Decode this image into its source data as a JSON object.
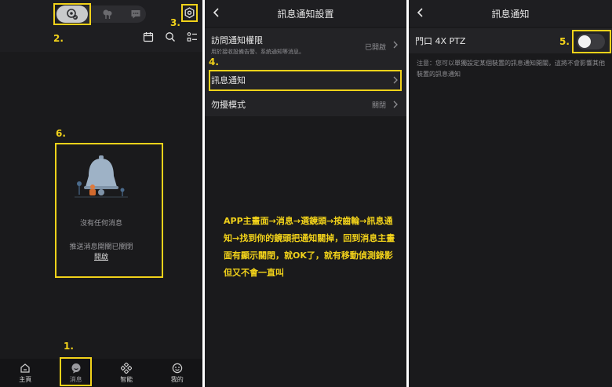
{
  "panel1": {
    "steps": {
      "s1": "1.",
      "s2": "2.",
      "s3": "3.",
      "s6": "6."
    },
    "empty": {
      "title": "沒有任何消息",
      "push_status": "推送消息開關已關閉",
      "enable_link": "開啟"
    },
    "tabs": [
      {
        "label": "主頁"
      },
      {
        "label": "消息"
      },
      {
        "label": "智能"
      },
      {
        "label": "我的"
      }
    ]
  },
  "panel2": {
    "title": "訊息通知設置",
    "step": "4.",
    "rows": [
      {
        "label": "訪問通知權限",
        "sub": "用於接收設備告警、系統通知等消息。",
        "value": "已開啟"
      },
      {
        "label": "訊息通知"
      },
      {
        "label": "勿擾模式",
        "value": "關閉"
      }
    ],
    "instruction": "APP主畫面→消息→選鏡頭→按齒輪→訊息通知→找到你的鏡頭把通知關掉，回到消息主畫面有顯示關閉，就OK了，就有移動偵測錄影但又不會一直叫"
  },
  "panel3": {
    "title": "訊息通知",
    "step": "5.",
    "device_name": "門口 4X PTZ",
    "toggle_on": false,
    "note": "注意：您可以單獨設定某個裝置的訊息通知開關，這將不會影響其他裝置的訊息通知"
  },
  "colors": {
    "accent": "#f2d21a",
    "bg": "#1a1a1c",
    "row_bg": "#232326"
  }
}
